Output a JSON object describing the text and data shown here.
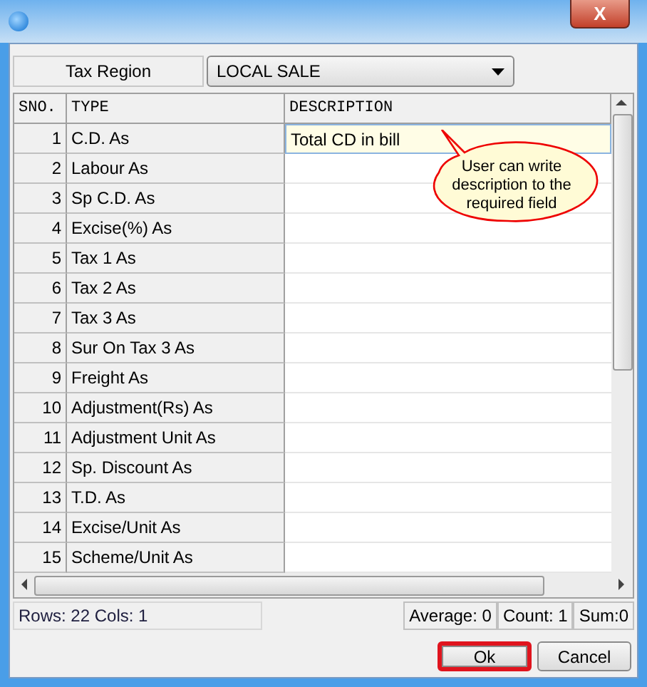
{
  "window": {
    "close": "X"
  },
  "tax_region": {
    "label": "Tax Region",
    "value": "LOCAL SALE"
  },
  "table": {
    "columns": [
      "SNO.",
      "TYPE",
      "DESCRIPTION"
    ],
    "rows": [
      {
        "sno": "1",
        "type": "C.D. As",
        "description": "Total CD in bill",
        "selected": true
      },
      {
        "sno": "2",
        "type": "Labour As",
        "description": "",
        "selected": false
      },
      {
        "sno": "3",
        "type": "Sp C.D. As",
        "description": "",
        "selected": false
      },
      {
        "sno": "4",
        "type": "Excise(%) As",
        "description": "",
        "selected": false
      },
      {
        "sno": "5",
        "type": "Tax 1 As",
        "description": "",
        "selected": false
      },
      {
        "sno": "6",
        "type": "Tax 2 As",
        "description": "",
        "selected": false
      },
      {
        "sno": "7",
        "type": "Tax 3 As",
        "description": "",
        "selected": false
      },
      {
        "sno": "8",
        "type": "Sur On Tax 3 As",
        "description": "",
        "selected": false
      },
      {
        "sno": "9",
        "type": "Freight As",
        "description": "",
        "selected": false
      },
      {
        "sno": "10",
        "type": "Adjustment(Rs) As",
        "description": "",
        "selected": false
      },
      {
        "sno": "11",
        "type": "Adjustment Unit As",
        "description": "",
        "selected": false
      },
      {
        "sno": "12",
        "type": "Sp. Discount As",
        "description": "",
        "selected": false
      },
      {
        "sno": "13",
        "type": "T.D. As",
        "description": "",
        "selected": false
      },
      {
        "sno": "14",
        "type": "Excise/Unit As",
        "description": "",
        "selected": false
      },
      {
        "sno": "15",
        "type": "Scheme/Unit As",
        "description": "",
        "selected": false
      }
    ]
  },
  "callout": "User can write description to the required field",
  "status_bar": {
    "left": "Rows: 22  Cols: 1",
    "right": [
      "Average: 0",
      "Count: 1",
      "Sum:0"
    ]
  },
  "buttons": [
    {
      "label": "Ok",
      "highlighted": true
    },
    {
      "label": "Cancel",
      "highlighted": false
    }
  ]
}
